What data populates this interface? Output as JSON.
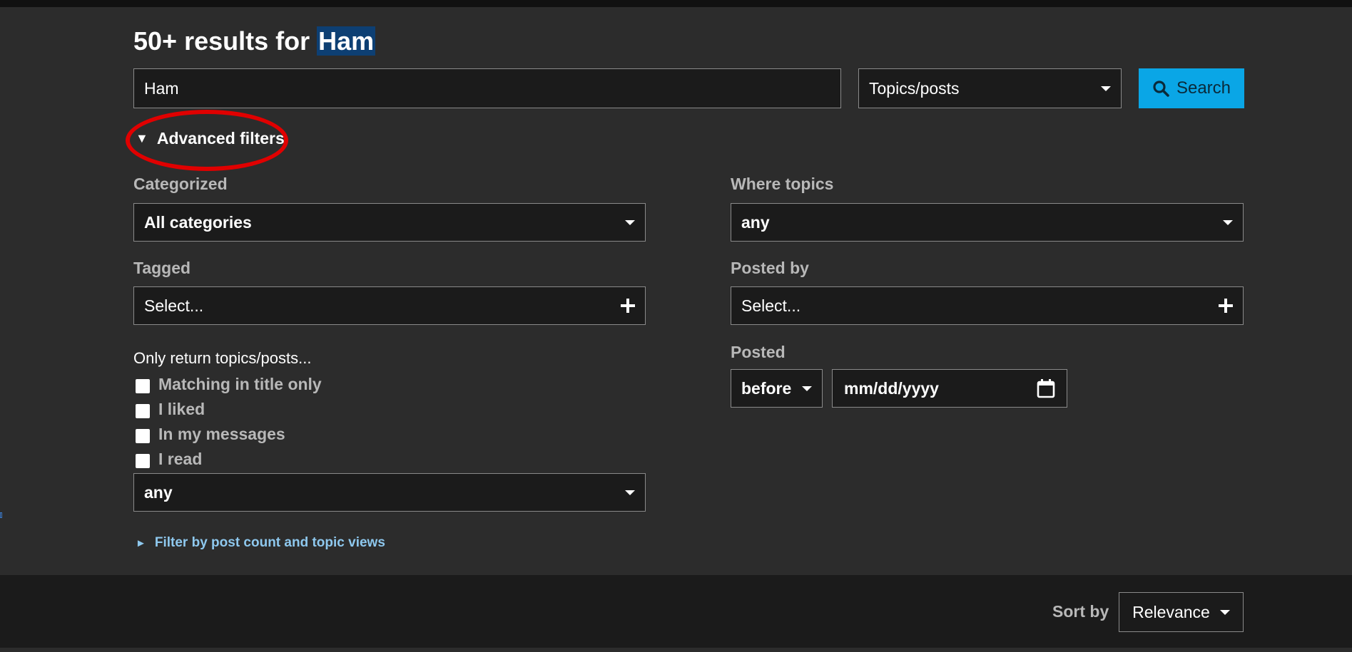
{
  "header": {
    "results_prefix": "50+ results for",
    "search_term": "Ham"
  },
  "search": {
    "query": "Ham",
    "type_select": "Topics/posts",
    "button_label": "Search"
  },
  "advanced": {
    "toggle_glyph": "▼",
    "toggle_label": "Advanced filters",
    "categorized_label": "Categorized",
    "categorized_value": "All categories",
    "tagged_label": "Tagged",
    "tagged_placeholder": "Select...",
    "where_topics_label": "Where topics",
    "where_topics_value": "any",
    "posted_by_label": "Posted by",
    "posted_by_placeholder": "Select...",
    "only_return_label": "Only return topics/posts...",
    "checkboxes": [
      {
        "label": "Matching in title only",
        "checked": false
      },
      {
        "label": "I liked",
        "checked": false
      },
      {
        "label": "In my messages",
        "checked": false
      },
      {
        "label": "I read",
        "checked": false
      }
    ],
    "only_return_value": "any",
    "posted_label": "Posted",
    "posted_when": "before",
    "posted_date_placeholder": "mm/dd/yyyy",
    "post_count_glyph": "►",
    "post_count_link": "Filter by post count and topic views"
  },
  "sort": {
    "label": "Sort by",
    "value": "Relevance"
  },
  "icons": {
    "search": "search-icon",
    "caret": "caret-down-icon",
    "plus": "plus-icon",
    "calendar": "calendar-icon"
  },
  "colors": {
    "accent": "#0aa6e6",
    "annotation": "#e00000",
    "link": "#8ec8ee",
    "term_highlight": "#0d3f73"
  }
}
